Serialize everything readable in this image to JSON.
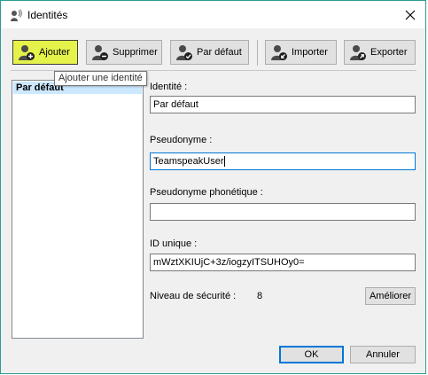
{
  "window": {
    "title": "Identités"
  },
  "toolbar": {
    "add": "Ajouter",
    "remove": "Supprimer",
    "default": "Par défaut",
    "import": "Importer",
    "export": "Exporter"
  },
  "tooltip": "Ajouter une identité",
  "identities": {
    "items": [
      "Par défaut"
    ]
  },
  "form": {
    "identity_label": "Identité :",
    "identity_value": "Par défaut",
    "nickname_label": "Pseudonyme :",
    "nickname_value": "TeamspeakUser",
    "phonetic_label": "Pseudonyme phonétique :",
    "phonetic_value": "",
    "uid_label": "ID unique :",
    "uid_value": "mWztXKIUjC+3z/iogzyITSUHOy0=",
    "security_label": "Niveau de sécurité :",
    "security_value": "8",
    "improve_label": "Améliorer"
  },
  "footer": {
    "ok": "OK",
    "cancel": "Annuler"
  },
  "colors": {
    "active_toolbar": "#e5f24a",
    "focus_border": "#0078d7",
    "selection": "#cce8ff"
  }
}
